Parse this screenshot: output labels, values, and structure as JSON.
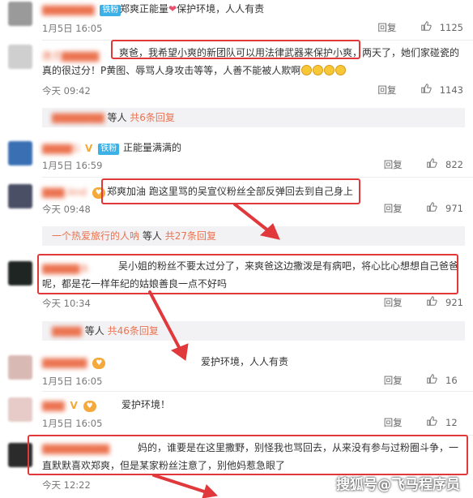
{
  "comments": [
    {
      "nickname": "▇▇▇▇▇▇▇",
      "badge": "铁粉",
      "text": "郑爽正能量",
      "text_after_icon": "保护环境，人人有责",
      "time": "1月5日 16:05",
      "reply_label": "回复",
      "likes": "1125"
    },
    {
      "nickname": "唐尤▇▇▇▇▇",
      "text_boxed": "爽爸，我希望小爽的新团队可以用法律武器来保护小爽",
      "text_rest": "，两天了，她们家碰瓷的真的很过分！P黄图、辱骂人身攻击等等，人善不能被人欺啊",
      "time": "今天 09:42",
      "reply_label": "回复",
      "likes": "1143",
      "subreply": {
        "name": "▇▇▇▇▇▇▇",
        "mid": "等人",
        "count": "共6条回复"
      }
    },
    {
      "nickname": "▇▇▇▇G",
      "badge": "铁粉",
      "text": "正能量满满的",
      "time": "1月5日 16:59",
      "reply_label": "回复",
      "likes": "822"
    },
    {
      "nickname": "▇▇▇ And",
      "text": "郑爽加油 跑这里骂的吴宣仪粉丝全部反弹回去到自己身上",
      "time": "今天 09:48",
      "reply_label": "回复",
      "likes": "971",
      "subreply": {
        "name": "一个热爱旅行的人呐",
        "mid": "等人",
        "count": "共27条回复"
      }
    },
    {
      "nickname": "▇▇▇▇▇水",
      "text": "吴小姐的粉丝不要太过分了，来爽爸这边撒泼是有病吧，将心比心想想自己爸爸呢，都是花一样年纪的姑娘善良一点不好吗",
      "time": "今天 10:34",
      "reply_label": "回复",
      "likes": "921",
      "subreply": {
        "name": "▇▇▇▇",
        "mid": "等人",
        "count": "共46条回复"
      }
    },
    {
      "nickname": "▇▇▇▇▇▇",
      "text": "爱护环境，人人有责",
      "time": "1月5日 16:05",
      "reply_label": "回复",
      "likes": "16"
    },
    {
      "nickname": "▇▇▇",
      "text": "爱护环境！",
      "time": "1月5日 16:05",
      "reply_label": "回复",
      "likes": "12"
    },
    {
      "nickname": "▇▇▇▇▇▇▇▇▇",
      "text": "妈的，谁要是在这里撒野，别怪我也骂回去，从来没有参与过粉圈斗争，一直默默喜欢郑爽，但是某家粉丝注意了，别他妈惹急眼了",
      "time": "今天 12:22",
      "reply_label": "回复",
      "likes": ""
    }
  ],
  "watermark": "搜狐号@飞马程序员",
  "colors": {
    "accent_nick": "#eb7350",
    "highlight_box": "#e0383b",
    "badge_iron": "#3bb1e8"
  },
  "icons": [
    "thumb-up-icon",
    "heart-icon",
    "emoji-icon",
    "verified-v-icon"
  ]
}
